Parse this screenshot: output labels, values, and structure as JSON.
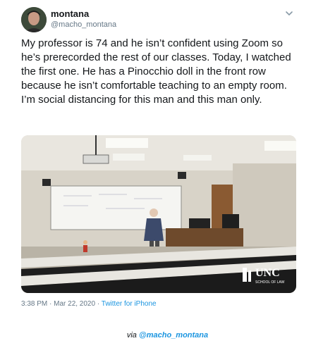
{
  "tweet": {
    "display_name": "montana",
    "handle": "@macho_montana",
    "text": "My professor is 74 and he isn’t confident using Zoom so he’s prerecorded the rest of our classes. Today, I watched the first one. He has a Pinocchio doll in the front row because he isn’t comfortable teaching to an empty room. I’m social distancing for this man and this man only.",
    "timestamp": "3:38 PM · Mar 22, 2020 · ",
    "source": "Twitter for iPhone",
    "menu_icon": "chevron-down-icon"
  },
  "photo": {
    "watermark_main": "UNC",
    "watermark_sub": "SCHOOL OF LAW"
  },
  "caption": {
    "prefix": "via ",
    "link": "@macho_montana"
  },
  "colors": {
    "text": "#14171a",
    "muted": "#657786",
    "link": "#1b95e0"
  }
}
